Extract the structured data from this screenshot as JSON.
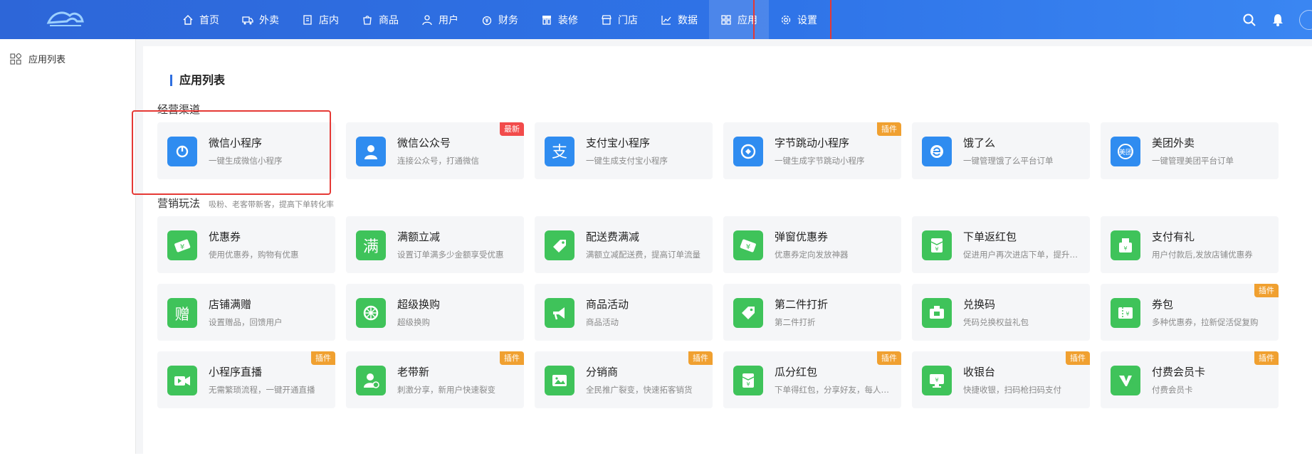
{
  "nav": {
    "items": [
      {
        "label": "首页",
        "icon": "home-icon"
      },
      {
        "label": "外卖",
        "icon": "delivery-icon"
      },
      {
        "label": "店内",
        "icon": "store-inside-icon"
      },
      {
        "label": "商品",
        "icon": "goods-icon"
      },
      {
        "label": "用户",
        "icon": "user-icon"
      },
      {
        "label": "财务",
        "icon": "finance-icon"
      },
      {
        "label": "装修",
        "icon": "decorate-icon"
      },
      {
        "label": "门店",
        "icon": "shop-icon"
      },
      {
        "label": "数据",
        "icon": "data-icon"
      },
      {
        "label": "应用",
        "icon": "apps-icon"
      },
      {
        "label": "设置",
        "icon": "gear-icon"
      }
    ],
    "active_index": 9
  },
  "sidebar": {
    "items": [
      {
        "label": "应用列表",
        "icon": "apps-grid-icon"
      }
    ]
  },
  "page": {
    "title": "应用列表"
  },
  "sections": [
    {
      "title": "经营渠道",
      "subtitle": ""
    },
    {
      "title": "营销玩法",
      "subtitle": "吸粉、老客带新客，提高下单转化率"
    }
  ],
  "channels": [
    {
      "name": "微信小程序",
      "desc": "一键生成微信小程序",
      "icon": "wechat-miniprogram-icon",
      "badge": ""
    },
    {
      "name": "微信公众号",
      "desc": "连接公众号，打通微信",
      "icon": "wechat-official-icon",
      "badge": "最新"
    },
    {
      "name": "支付宝小程序",
      "desc": "一键生成支付宝小程序",
      "icon": "alipay-icon",
      "badge": ""
    },
    {
      "name": "字节跳动小程序",
      "desc": "一键生成字节跳动小程序",
      "icon": "bytedance-icon",
      "badge": "插件"
    },
    {
      "name": "饿了么",
      "desc": "一键管理饿了么平台订单",
      "icon": "eleme-icon",
      "badge": ""
    },
    {
      "name": "美团外卖",
      "desc": "一键管理美团平台订单",
      "icon": "meituan-icon",
      "badge": ""
    }
  ],
  "marketing": [
    {
      "name": "优惠券",
      "desc": "使用优惠券，购物有优惠",
      "icon": "coupon-icon",
      "badge": ""
    },
    {
      "name": "满额立减",
      "desc": "设置订单满多少金额享受优惠",
      "icon": "full-reduce-icon",
      "badge": ""
    },
    {
      "name": "配送费满减",
      "desc": "满额立减配送费，提高订单流量",
      "icon": "delivery-fee-icon",
      "badge": ""
    },
    {
      "name": "弹窗优惠券",
      "desc": "优惠券定向发放神器",
      "icon": "popup-coupon-icon",
      "badge": ""
    },
    {
      "name": "下单返红包",
      "desc": "促进用户再次进店下单，提升复购",
      "icon": "red-envelope-icon",
      "badge": ""
    },
    {
      "name": "支付有礼",
      "desc": "用户付款后,发放店铺优惠券",
      "icon": "pay-gift-icon",
      "badge": ""
    },
    {
      "name": "店铺满赠",
      "desc": "设置赠品，回馈用户",
      "icon": "gift-icon",
      "badge": ""
    },
    {
      "name": "超级换购",
      "desc": "超级换购",
      "icon": "exchange-icon",
      "badge": ""
    },
    {
      "name": "商品活动",
      "desc": "商品活动",
      "icon": "megaphone-icon",
      "badge": ""
    },
    {
      "name": "第二件打折",
      "desc": "第二件打折",
      "icon": "discount-tag-icon",
      "badge": ""
    },
    {
      "name": "兑换码",
      "desc": "凭码兑换权益礼包",
      "icon": "redeem-code-icon",
      "badge": ""
    },
    {
      "name": "券包",
      "desc": "多种优惠券，拉新促活促复购",
      "icon": "coupon-pack-icon",
      "badge": "插件"
    },
    {
      "name": "小程序直播",
      "desc": "无需繁琐流程，一键开通直播",
      "icon": "live-video-icon",
      "badge": "插件"
    },
    {
      "name": "老带新",
      "desc": "刺激分享，新用户快速裂变",
      "icon": "referral-icon",
      "badge": "插件"
    },
    {
      "name": "分销商",
      "desc": "全民推广裂变，快速拓客销货",
      "icon": "distributor-icon",
      "badge": "插件"
    },
    {
      "name": "瓜分红包",
      "desc": "下单得红包，分享好友，每人均分",
      "icon": "split-envelope-icon",
      "badge": "插件"
    },
    {
      "name": "收银台",
      "desc": "快捷收银，扫码枪扫码支付",
      "icon": "cashier-icon",
      "badge": "插件"
    },
    {
      "name": "付费会员卡",
      "desc": "付费会员卡",
      "icon": "vip-card-icon",
      "badge": "插件"
    }
  ],
  "colors": {
    "topbar": "#2f6fe0",
    "channel_icon": "#2f8cf0",
    "marketing_icon": "#3fc35a",
    "badge_new": "#f24b4b",
    "badge_plugin": "#f0a030",
    "highlight": "#e53935"
  }
}
